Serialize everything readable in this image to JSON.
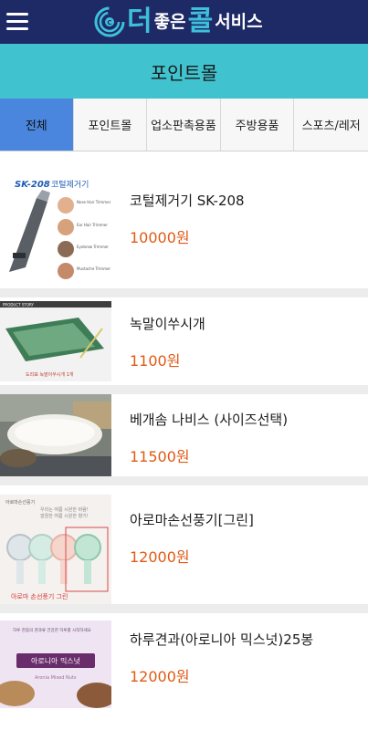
{
  "header": {
    "logo_big_1": "더",
    "logo_small_1": "좋은",
    "logo_big_2": "콜",
    "logo_small_2": "서비스"
  },
  "page_title": "포인트몰",
  "tabs": [
    {
      "label": "전체",
      "active": true
    },
    {
      "label": "포인트몰",
      "active": false
    },
    {
      "label": "업소판촉용품",
      "active": false
    },
    {
      "label": "주방용품",
      "active": false
    },
    {
      "label": "스포츠/레저",
      "active": false
    }
  ],
  "products": [
    {
      "name": "코털제거기 SK-208",
      "price": "10000원",
      "image_text": {
        "model": "SK-208",
        "title": "코털제거기",
        "labels": [
          "Nose Hair Trimmer",
          "Ear Hair Trimmer",
          "Eyebrow Trimmer",
          "Mustache Trimmer"
        ]
      }
    },
    {
      "name": "녹말이쑤시개",
      "price": "1100원",
      "image_text": {
        "header": "PRODUCT STORY",
        "caption": "도리표 녹말이쑤시개 1개"
      }
    },
    {
      "name": "베개솜 나비스 (사이즈선택)",
      "price": "11500원"
    },
    {
      "name": "아로마손선풍기[그린]",
      "price": "12000원",
      "image_text": {
        "caption": "아로마 손선풍기 그린",
        "tag": "아로마손선풍기",
        "lines": [
          "우리는 여름 시원한 바람!",
          "깔끔한 여름 시원한 향기!"
        ]
      }
    },
    {
      "name": "하루견과(아로니아 믹스넛)25봉",
      "price": "12000원",
      "image_text": {
        "top": "하루 한줌의 견과류 건강한 하루를 시작하세요",
        "label": "아로니아 믹스넛",
        "sub": "Aronia Mixed Nuts"
      }
    }
  ],
  "colors": {
    "header_bg": "#1e2a66",
    "title_bg": "#40c3cf",
    "active_tab": "#4a86dd",
    "price": "#e05a14",
    "logo_accent": "#3ec0dc"
  }
}
